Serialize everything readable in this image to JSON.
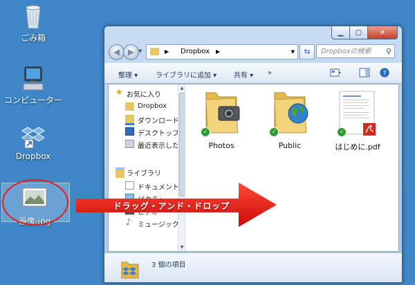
{
  "desktop": {
    "icons": [
      {
        "label": "ごみ箱",
        "icon": "recycle-bin-icon"
      },
      {
        "label": "コンピューター",
        "icon": "computer-icon"
      },
      {
        "label": "Dropbox",
        "icon": "dropbox-shortcut-icon"
      },
      {
        "label": "画像.jpg",
        "icon": "image-file-icon"
      }
    ]
  },
  "window": {
    "address": {
      "crumb": "Dropbox",
      "separator": "▶"
    },
    "search_placeholder": "Dropboxの検索",
    "toolbar": {
      "organize": "整理 ▾",
      "add_to_library": "ライブラリに追加 ▾",
      "share": "共有 ▾",
      "more": "»"
    },
    "nav": {
      "favorites": {
        "label": "お気に入り",
        "items": [
          "Dropbox",
          "ダウンロード",
          "デスクトップ",
          "最近表示した"
        ]
      },
      "libraries": {
        "label": "ライブラリ",
        "items": [
          "ドキュメント",
          "ピクチャ",
          "ビデオ",
          "ミュージック"
        ]
      }
    },
    "files": [
      {
        "name": "Photos",
        "type": "folder-camera"
      },
      {
        "name": "Public",
        "type": "folder-globe"
      },
      {
        "name": "はじめに.pdf",
        "type": "pdf"
      }
    ],
    "status": "3 個の項目"
  },
  "annotation": {
    "label": "ドラッグ・アンド・ドロップ",
    "arrow_color": "#e8140c"
  }
}
